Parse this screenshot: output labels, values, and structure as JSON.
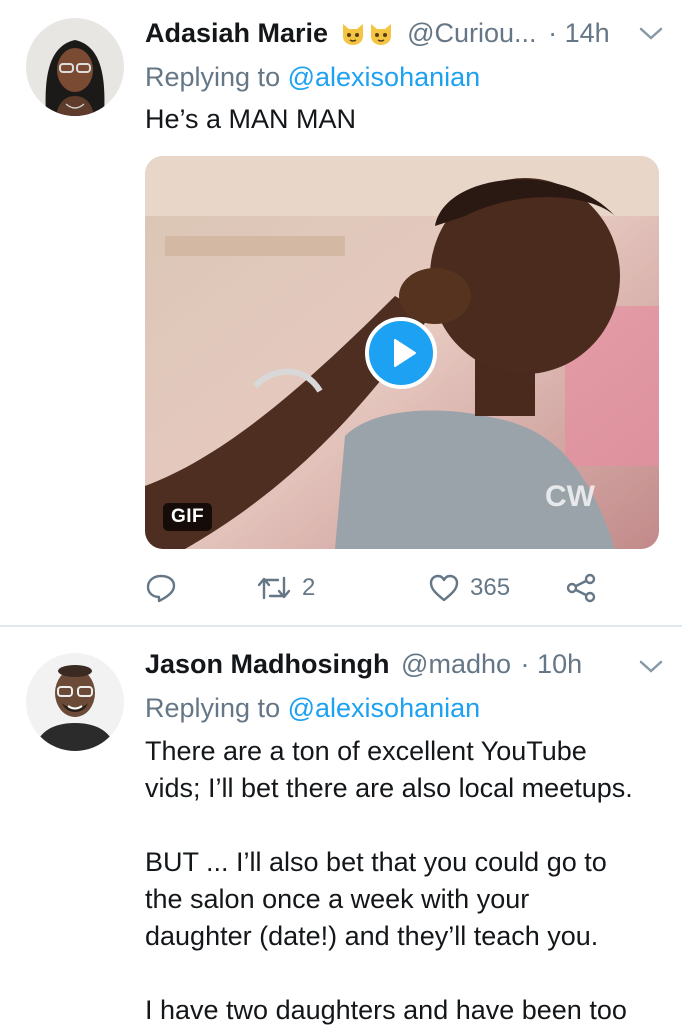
{
  "tweets": [
    {
      "name": "Adasiah Marie",
      "emojis": [
        "cat-face-icon",
        "cat-face-icon"
      ],
      "handle": "@Curiou...",
      "dot": "·",
      "time": "14h",
      "replying_prefix": "Replying to",
      "replying_to": "@alexisohanian",
      "text": "He’s a MAN MAN",
      "media": {
        "badge": "GIF",
        "watermark": "CW"
      },
      "actions": {
        "reply_count": "",
        "retweet_count": "2",
        "like_count": "365"
      }
    },
    {
      "name": "Jason Madhosingh",
      "handle": "@madho",
      "dot": "·",
      "time": "10h",
      "replying_prefix": "Replying to",
      "replying_to": "@alexisohanian",
      "paragraphs": [
        [
          "There are a ton of excellent YouTube",
          "vids; I’ll bet there are also local meetups."
        ],
        [
          "BUT ... I’ll also bet that you could go to",
          "the salon once a week with your",
          "daughter (date!) and they’ll teach you."
        ],
        [
          "I have two daughters and have been too"
        ]
      ]
    }
  ],
  "colors": {
    "link": "#1da1f2",
    "muted": "#657786",
    "divider": "#e1e8ed"
  }
}
